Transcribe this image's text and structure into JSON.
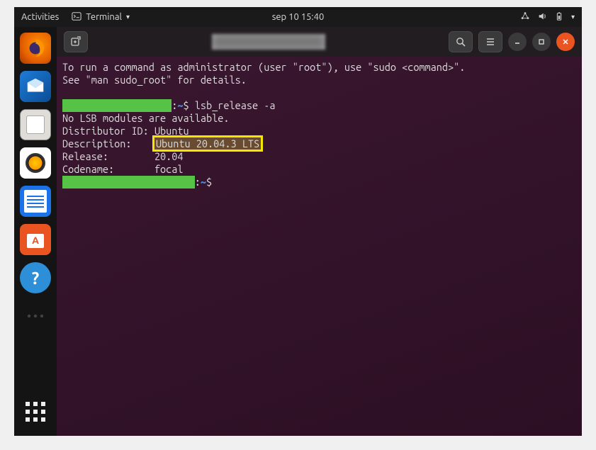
{
  "topbar": {
    "activities": "Activities",
    "app_name": "Terminal",
    "datetime": "sep 10  15:40"
  },
  "dock": {
    "firefox": "Firefox",
    "thunderbird": "Thunderbird",
    "files": "Files",
    "rhythmbox": "Rhythmbox",
    "writer": "LibreOffice Writer",
    "software": "Ubuntu Software",
    "help": "Help",
    "apps": "Show Applications"
  },
  "window": {
    "new_tab_tooltip": "New Tab",
    "search_tooltip": "Search",
    "menu_tooltip": "Menu",
    "minimize": "Minimize",
    "maximize": "Maximize",
    "close": "Close"
  },
  "terminal": {
    "sudo_hint_1": "To run a command as administrator (user \"root\"), use \"sudo <command>\".",
    "sudo_hint_2": "See \"man sudo_root\" for details.",
    "prompt_sep": ":",
    "prompt_path": "~",
    "prompt_char": "$",
    "command": "lsb_release -a",
    "no_lsb": "No LSB modules are available.",
    "distributor_label": "Distributor ID:",
    "distributor_value": "Ubuntu",
    "description_label": "Description:",
    "description_value": "Ubuntu 20.04.3 LTS",
    "release_label": "Release:",
    "release_value": "20.04",
    "codename_label": "Codename:",
    "codename_value": "focal"
  }
}
